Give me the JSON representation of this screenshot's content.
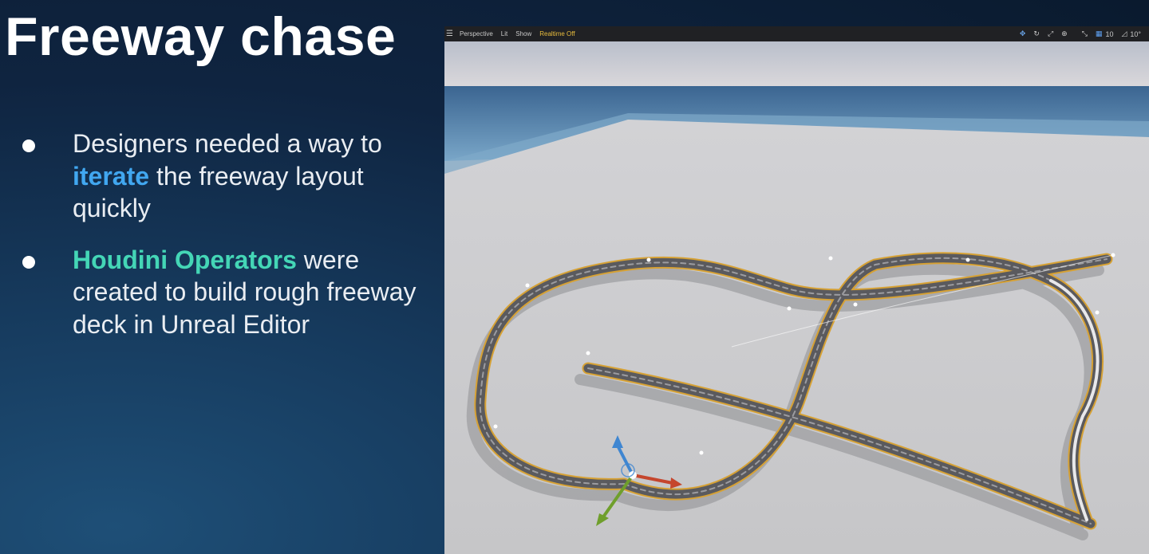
{
  "slide": {
    "title": "Freeway chase",
    "bullets": [
      {
        "pre": "Designers needed a way to ",
        "highlight": "iterate",
        "post": " the freeway layout quickly"
      },
      {
        "pre": "",
        "highlight": "Houdini Operators",
        "post": " were created to build rough freeway deck in Unreal Editor"
      }
    ]
  },
  "viewport": {
    "menu_icon": "hamburger-menu-icon",
    "view_mode": "Perspective",
    "lighting": "Lit",
    "show": "Show",
    "realtime": "Realtime Off",
    "grid_snap_value": "10",
    "rotation_snap_value": "10°"
  },
  "colors": {
    "highlight_blue": "#41a7f0",
    "highlight_teal": "#44d6b6",
    "realtime_yellow": "#e9bd3d",
    "spline_orange": "#d6a134"
  }
}
